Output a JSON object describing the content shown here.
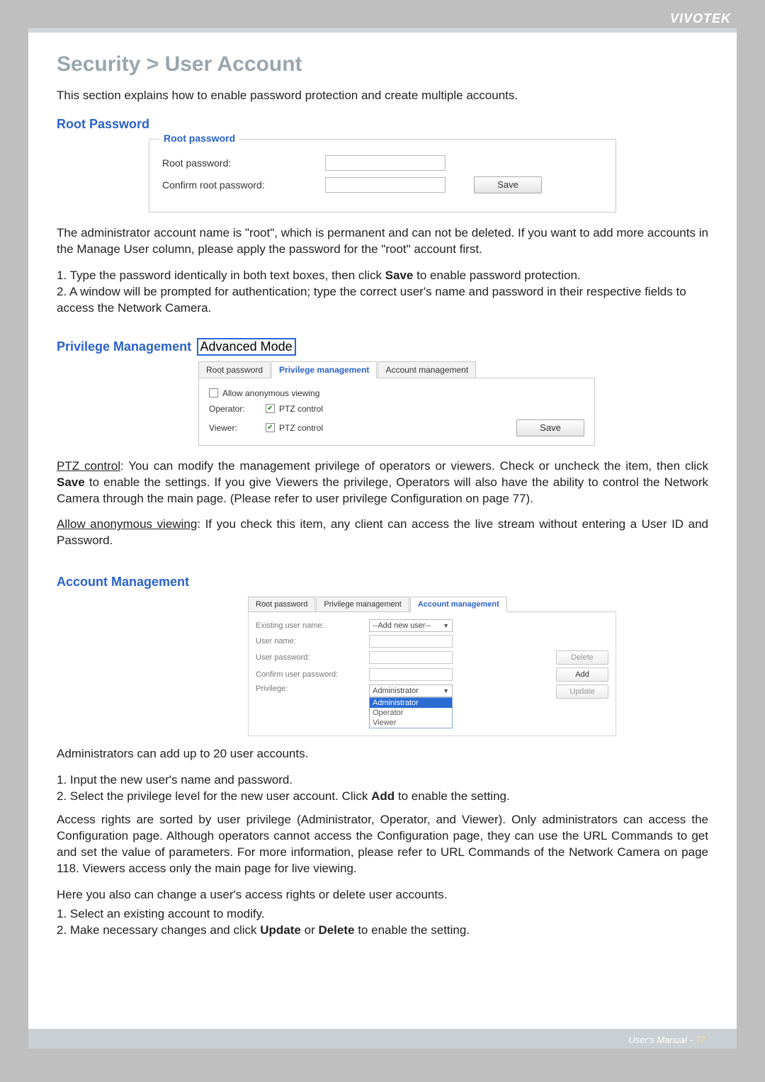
{
  "brand": "VIVOTEK",
  "page_title": "Security > User Account",
  "intro": "This section explains how to enable password protection and create multiple accounts.",
  "root_password": {
    "heading": "Root Password",
    "legend": "Root password",
    "labels": {
      "root_pw": "Root password:",
      "confirm_pw": "Confirm root password:"
    },
    "save": "Save",
    "desc_pre": "The administrator account name is \"root\", which is permanent and can not be deleted. If you want to add more accounts in the Manage User column, please apply the password for the \"root\" account first.",
    "step1_pre": "1. Type the password identically in both text boxes, then click ",
    "step1_bold": "Save",
    "step1_post": " to enable password protection.",
    "step2": "2. A window will be prompted for authentication; type the correct user's name and password in their respective fields to access the Network Camera."
  },
  "privilege": {
    "heading": "Privilege Management",
    "advanced": "Advanced Mode",
    "tabs": [
      "Root password",
      "Privilege management",
      "Account management"
    ],
    "allow_anon": "Allow anonymous viewing",
    "operator": "Operator:",
    "viewer": "Viewer:",
    "ptz": "PTZ control",
    "save": "Save",
    "ptz_para_pre": "PTZ control",
    "ptz_para_mid1": ": You can modify the management privilege of operators or viewers. Check or uncheck the item, then click ",
    "ptz_para_bold": "Save",
    "ptz_para_mid2": " to enable the settings. If you give Viewers the privilege, Operators will also have the ability to control the Network Camera through the main page. (Please refer to user privilege Configuration on page 77).",
    "anon_para_pre": "Allow anonymous viewing",
    "anon_para_post": ": If you check this item, any client can access the live stream without entering a User ID and Password."
  },
  "account": {
    "heading": "Account Management",
    "tabs": [
      "Root password",
      "Privilege management",
      "Account management"
    ],
    "labels": {
      "existing": "Existing user name:",
      "user": "User name:",
      "password": "User password:",
      "confirm": "Confirm user password:",
      "privilege": "Privilege:"
    },
    "existing_value": "--Add new user--",
    "buttons": {
      "delete": "Delete",
      "add": "Add",
      "update": "Update"
    },
    "priv_selected": "Administrator",
    "priv_options": [
      "Administrator",
      "Operator",
      "Viewer"
    ],
    "para1": "Administrators can add up to 20 user accounts.",
    "para1_s1": "1. Input the new user's name and password.",
    "para1_s2_pre": "2. Select the privilege level for the new user account. Click ",
    "para1_s2_bold": "Add",
    "para1_s2_post": " to enable the setting.",
    "para2": "Access rights are sorted by user privilege (Administrator, Operator, and Viewer). Only administrators can access the Configuration page. Although operators cannot access the Configuration page, they can use the URL Commands to get and set the value of parameters. For more information, please refer to URL Commands of the Network Camera on page 118. Viewers access only the main page for live viewing.",
    "para3": "Here you also can change a user's access rights or delete user accounts.",
    "para3_s1": "1. Select an existing account to modify.",
    "para3_s2_pre": "2. Make necessary changes and click ",
    "para3_s2_b1": "Update",
    "para3_s2_mid": " or ",
    "para3_s2_b2": "Delete",
    "para3_s2_post": " to enable the setting."
  },
  "footer": {
    "label": "User's Manual - ",
    "page": "77"
  }
}
